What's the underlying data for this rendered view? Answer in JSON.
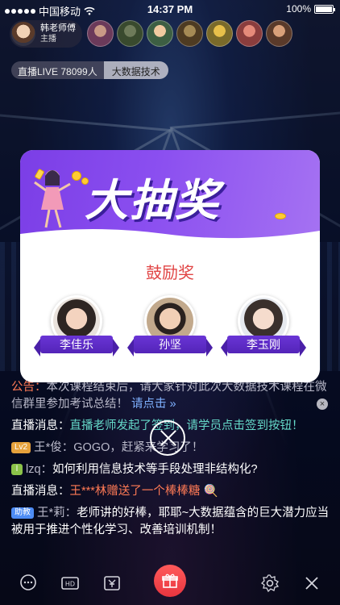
{
  "status_bar": {
    "carrier": "中国移动",
    "time": "14:37 PM",
    "battery": "100%"
  },
  "host": {
    "name": "韩老师傅",
    "role": "主播"
  },
  "room": {
    "live_label": "直播LIVE 78099人",
    "topic": "大数据技术"
  },
  "popup": {
    "banner_title": "大抽奖",
    "prize_title": "鼓励奖",
    "winners": [
      {
        "name": "李佳乐"
      },
      {
        "name": "孙坚"
      },
      {
        "name": "李玉刚"
      }
    ]
  },
  "chat": {
    "line1_prefix": "公告：",
    "line1_text": "本次课程结束后，请大家针对此次大数据技术课程在微信群里参加考试总结！",
    "line1_link": "请点击 »",
    "line2_label": "直播消息：",
    "line2_text": "直播老师发起了签到，请学员点击签到按钮！",
    "line3_badge": "Lv2",
    "line3_name": "王*俊：",
    "line3_text": "GOGO，赶紧来学习了！",
    "line4_badge": "l",
    "line4_name": "lzq：",
    "line4_text": "如何利用信息技术等手段处理非结构化?",
    "line5_label": "直播消息：",
    "line5_text": "王***林赠送了一个棒棒糖",
    "line6_badge": "助教",
    "line6_name": "王*莉：",
    "line6_text": "老师讲的好棒，耶耶~大数据蕴含的巨大潜力应当被用于推进个性化学习、改善培训机制！"
  },
  "icons": {
    "wifi": "wifi-icon",
    "chat": "chat-bubble-icon",
    "hd": "hd-icon",
    "yen": "yen-icon",
    "gift": "gift-icon",
    "settings": "gear-icon",
    "close": "close-icon"
  },
  "colors": {
    "accent_purple": "#7b3ee6",
    "prize_red": "#e14545",
    "gift_red": "#e8353f"
  }
}
